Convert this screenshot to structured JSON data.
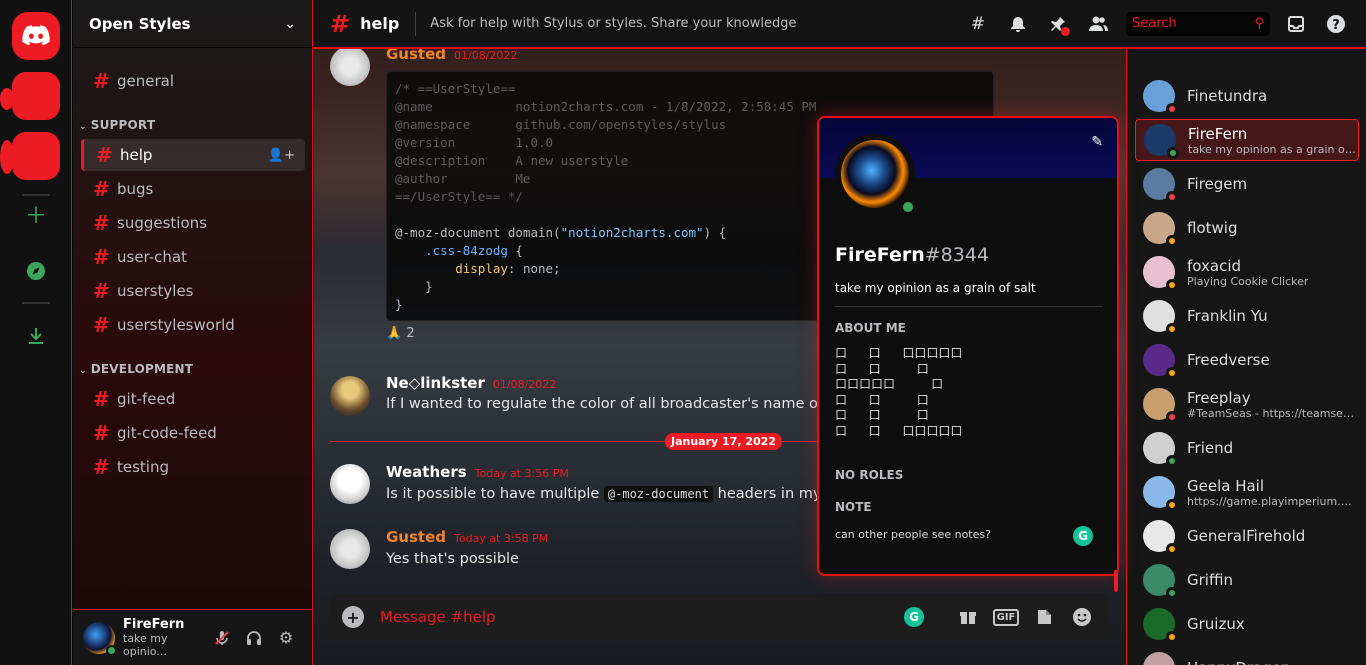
{
  "guild": {
    "name": "Open Styles"
  },
  "channels": {
    "top": [
      {
        "label": "general"
      }
    ],
    "support_category": "SUPPORT",
    "support": [
      {
        "label": "help",
        "active": true
      },
      {
        "label": "bugs"
      },
      {
        "label": "suggestions"
      },
      {
        "label": "user-chat"
      },
      {
        "label": "userstyles"
      },
      {
        "label": "userstylesworld"
      }
    ],
    "development_category": "DEVELOPMENT",
    "development": [
      {
        "label": "git-feed"
      },
      {
        "label": "git-code-feed"
      },
      {
        "label": "testing"
      }
    ]
  },
  "user_panel": {
    "name": "FireFern",
    "status": "take my opinio..."
  },
  "topbar": {
    "channel": "help",
    "topic": "Ask for help with Stylus or styles. Share your knowledge",
    "search_placeholder": "Search"
  },
  "messages": [
    {
      "author": "Gusted",
      "author_color": "#f0842c",
      "time": "01/08/2022"
    },
    {
      "author": "Ne◇linkster",
      "author_color": "#ffffff",
      "time": "01/08/2022",
      "text": "If I wanted to regulate the color of all broadcaster's name on twitc"
    },
    {
      "author": "Weathers",
      "author_color": "#ffffff",
      "time": "Today at 3:56 PM",
      "text_before": "Is it possible to have multiple ",
      "code": "@-moz-document",
      "text_after": " headers in my styl"
    },
    {
      "author": "Gusted",
      "author_color": "#f0842c",
      "time": "Today at 3:58 PM",
      "text": "Yes that's possible"
    }
  ],
  "code_lines": {
    "l1": "/* ==UserStyle==",
    "l2": "@name           notion2charts.com - 1/8/2022, 2:58:45 PM",
    "l3": "@namespace      github.com/openstyles/stylus",
    "l4": "@version        1.0.0",
    "l5": "@description    A new userstyle",
    "l6": "@author         Me",
    "l7": "==/UserStyle== */",
    "l8a": "@-moz-document domain(",
    "l8b": "\"notion2charts.com\"",
    "l8c": ") {",
    "l9": ".css-84zodg",
    "l9b": " {",
    "l10a": "display",
    "l10b": ": none;",
    "l11": "    }",
    "l12": "}"
  },
  "reaction": {
    "emoji": "🙏",
    "count": "2"
  },
  "date_divider": "January 17, 2022",
  "composer": {
    "placeholder": "Message #help",
    "gif_label": "GIF"
  },
  "profile": {
    "username": "FireFern",
    "discriminator": "#8344",
    "custom_status": "take my opinion as a grain of salt",
    "about_heading": "ABOUT ME",
    "about_text": "口   口   口口口口口\n口   口     口\n口口口口口     口\n口   口     口\n口   口     口\n口   口   口口口口口",
    "roles_heading": "NO ROLES",
    "note_heading": "NOTE",
    "note_text": "can other people see notes?"
  },
  "members": [
    {
      "name": "Finetundra",
      "sub": "",
      "status": "dnd",
      "avatar_color": "#6aa0d8"
    },
    {
      "name": "FireFern",
      "sub": "take my opinion as a grain of s...",
      "status": "online",
      "avatar_color": "#1a3a6a",
      "selected": true
    },
    {
      "name": "Firegem",
      "sub": "",
      "status": "dnd",
      "avatar_color": "#5a7aa0"
    },
    {
      "name": "flotwig",
      "sub": "",
      "status": "idle",
      "avatar_color": "#c9a88a"
    },
    {
      "name": "foxacid",
      "sub": "Playing Cookie Clicker",
      "status": "idle",
      "avatar_color": "#e8c0d0"
    },
    {
      "name": "Franklin Yu",
      "sub": "",
      "status": "idle",
      "avatar_color": "#e0e0e0"
    },
    {
      "name": "Freedverse",
      "sub": "",
      "status": "idle",
      "avatar_color": "#5a2a8a"
    },
    {
      "name": "Freeplay",
      "sub": "#TeamSeas - https://teamsea...",
      "status": "dnd",
      "avatar_color": "#c8a070"
    },
    {
      "name": "Friend",
      "sub": "",
      "status": "online",
      "avatar_color": "#d0d0d0"
    },
    {
      "name": "Geela Hail",
      "sub": "https://game.playimperium.c...",
      "status": "idle",
      "avatar_color": "#8ab8e8"
    },
    {
      "name": "GeneralFirehold",
      "sub": "",
      "status": "idle",
      "avatar_color": "#e8e8e8"
    },
    {
      "name": "Griffin",
      "sub": "",
      "status": "online",
      "avatar_color": "#3a8a6a"
    },
    {
      "name": "Gruizux",
      "sub": "",
      "status": "idle",
      "avatar_color": "#1a6a2a"
    },
    {
      "name": "HappyDragon",
      "sub": "",
      "status": "idle",
      "avatar_color": "#c0a0a0"
    }
  ],
  "status_colors": {
    "online": "#3ba55d",
    "idle": "#faa61a",
    "dnd": "#ed4245"
  }
}
